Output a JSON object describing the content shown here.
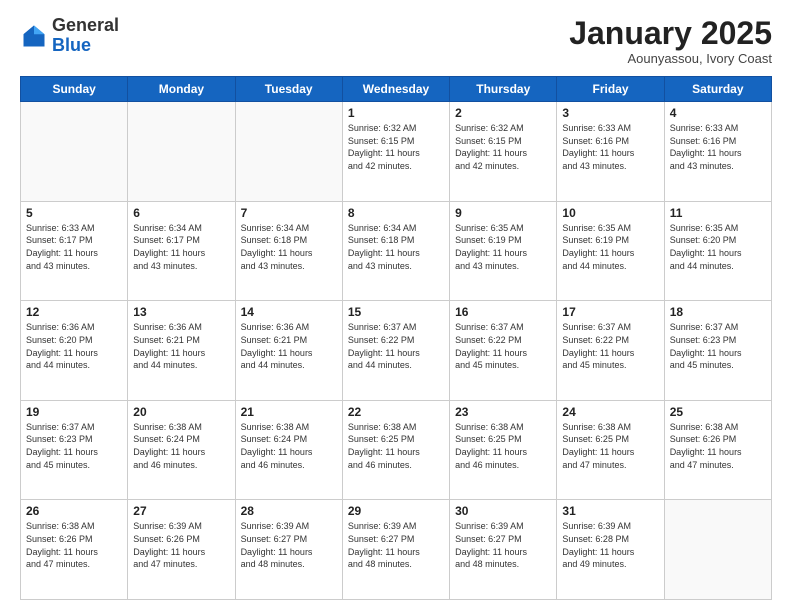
{
  "header": {
    "logo": {
      "general": "General",
      "blue": "Blue"
    },
    "title": "January 2025",
    "subtitle": "Aounyassou, Ivory Coast"
  },
  "weekdays": [
    "Sunday",
    "Monday",
    "Tuesday",
    "Wednesday",
    "Thursday",
    "Friday",
    "Saturday"
  ],
  "weeks": [
    [
      {
        "day": "",
        "info": "",
        "empty": true
      },
      {
        "day": "",
        "info": "",
        "empty": true
      },
      {
        "day": "",
        "info": "",
        "empty": true
      },
      {
        "day": "1",
        "info": "Sunrise: 6:32 AM\nSunset: 6:15 PM\nDaylight: 11 hours\nand 42 minutes."
      },
      {
        "day": "2",
        "info": "Sunrise: 6:32 AM\nSunset: 6:15 PM\nDaylight: 11 hours\nand 42 minutes."
      },
      {
        "day": "3",
        "info": "Sunrise: 6:33 AM\nSunset: 6:16 PM\nDaylight: 11 hours\nand 43 minutes."
      },
      {
        "day": "4",
        "info": "Sunrise: 6:33 AM\nSunset: 6:16 PM\nDaylight: 11 hours\nand 43 minutes."
      }
    ],
    [
      {
        "day": "5",
        "info": "Sunrise: 6:33 AM\nSunset: 6:17 PM\nDaylight: 11 hours\nand 43 minutes."
      },
      {
        "day": "6",
        "info": "Sunrise: 6:34 AM\nSunset: 6:17 PM\nDaylight: 11 hours\nand 43 minutes."
      },
      {
        "day": "7",
        "info": "Sunrise: 6:34 AM\nSunset: 6:18 PM\nDaylight: 11 hours\nand 43 minutes."
      },
      {
        "day": "8",
        "info": "Sunrise: 6:34 AM\nSunset: 6:18 PM\nDaylight: 11 hours\nand 43 minutes."
      },
      {
        "day": "9",
        "info": "Sunrise: 6:35 AM\nSunset: 6:19 PM\nDaylight: 11 hours\nand 43 minutes."
      },
      {
        "day": "10",
        "info": "Sunrise: 6:35 AM\nSunset: 6:19 PM\nDaylight: 11 hours\nand 44 minutes."
      },
      {
        "day": "11",
        "info": "Sunrise: 6:35 AM\nSunset: 6:20 PM\nDaylight: 11 hours\nand 44 minutes."
      }
    ],
    [
      {
        "day": "12",
        "info": "Sunrise: 6:36 AM\nSunset: 6:20 PM\nDaylight: 11 hours\nand 44 minutes."
      },
      {
        "day": "13",
        "info": "Sunrise: 6:36 AM\nSunset: 6:21 PM\nDaylight: 11 hours\nand 44 minutes."
      },
      {
        "day": "14",
        "info": "Sunrise: 6:36 AM\nSunset: 6:21 PM\nDaylight: 11 hours\nand 44 minutes."
      },
      {
        "day": "15",
        "info": "Sunrise: 6:37 AM\nSunset: 6:22 PM\nDaylight: 11 hours\nand 44 minutes."
      },
      {
        "day": "16",
        "info": "Sunrise: 6:37 AM\nSunset: 6:22 PM\nDaylight: 11 hours\nand 45 minutes."
      },
      {
        "day": "17",
        "info": "Sunrise: 6:37 AM\nSunset: 6:22 PM\nDaylight: 11 hours\nand 45 minutes."
      },
      {
        "day": "18",
        "info": "Sunrise: 6:37 AM\nSunset: 6:23 PM\nDaylight: 11 hours\nand 45 minutes."
      }
    ],
    [
      {
        "day": "19",
        "info": "Sunrise: 6:37 AM\nSunset: 6:23 PM\nDaylight: 11 hours\nand 45 minutes."
      },
      {
        "day": "20",
        "info": "Sunrise: 6:38 AM\nSunset: 6:24 PM\nDaylight: 11 hours\nand 46 minutes."
      },
      {
        "day": "21",
        "info": "Sunrise: 6:38 AM\nSunset: 6:24 PM\nDaylight: 11 hours\nand 46 minutes."
      },
      {
        "day": "22",
        "info": "Sunrise: 6:38 AM\nSunset: 6:25 PM\nDaylight: 11 hours\nand 46 minutes."
      },
      {
        "day": "23",
        "info": "Sunrise: 6:38 AM\nSunset: 6:25 PM\nDaylight: 11 hours\nand 46 minutes."
      },
      {
        "day": "24",
        "info": "Sunrise: 6:38 AM\nSunset: 6:25 PM\nDaylight: 11 hours\nand 47 minutes."
      },
      {
        "day": "25",
        "info": "Sunrise: 6:38 AM\nSunset: 6:26 PM\nDaylight: 11 hours\nand 47 minutes."
      }
    ],
    [
      {
        "day": "26",
        "info": "Sunrise: 6:38 AM\nSunset: 6:26 PM\nDaylight: 11 hours\nand 47 minutes."
      },
      {
        "day": "27",
        "info": "Sunrise: 6:39 AM\nSunset: 6:26 PM\nDaylight: 11 hours\nand 47 minutes."
      },
      {
        "day": "28",
        "info": "Sunrise: 6:39 AM\nSunset: 6:27 PM\nDaylight: 11 hours\nand 48 minutes."
      },
      {
        "day": "29",
        "info": "Sunrise: 6:39 AM\nSunset: 6:27 PM\nDaylight: 11 hours\nand 48 minutes."
      },
      {
        "day": "30",
        "info": "Sunrise: 6:39 AM\nSunset: 6:27 PM\nDaylight: 11 hours\nand 48 minutes."
      },
      {
        "day": "31",
        "info": "Sunrise: 6:39 AM\nSunset: 6:28 PM\nDaylight: 11 hours\nand 49 minutes."
      },
      {
        "day": "",
        "info": "",
        "empty": true
      }
    ]
  ]
}
